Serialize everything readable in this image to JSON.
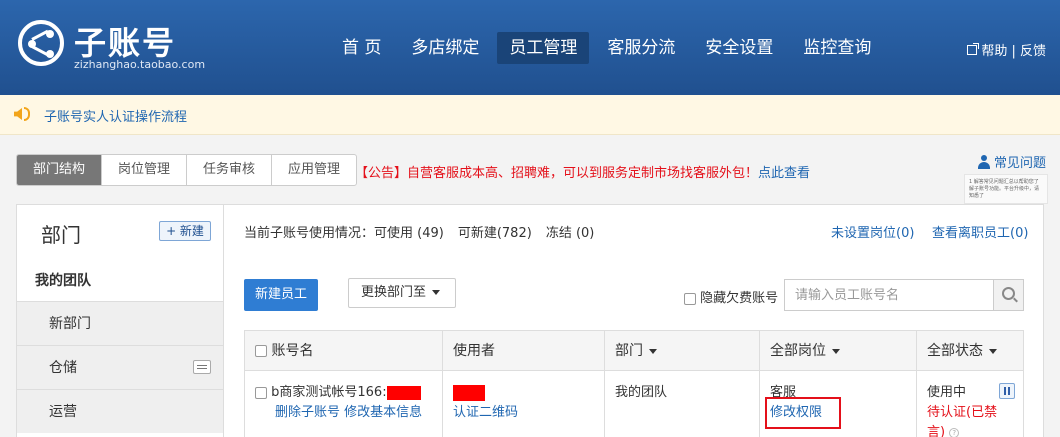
{
  "header": {
    "brand": "子账号",
    "brand_sub": "zizhanghao.taobao.com",
    "nav": [
      "首 页",
      "多店绑定",
      "员工管理",
      "客服分流",
      "安全设置",
      "监控查询"
    ],
    "help": "帮助 | 反馈"
  },
  "notice": {
    "text": "子账号实人认证操作流程"
  },
  "tabs": [
    "部门结构",
    "岗位管理",
    "任务审核",
    "应用管理"
  ],
  "announcement": {
    "prefix": "【公告】自营客服成本高、招聘难，可以到服务定制市场找客服外包！",
    "link": "点此查看"
  },
  "faq": {
    "label": "常见问题",
    "note": "1 解答常见问题汇总以帮助您了解子账号功能。平台升级中，请知悉了"
  },
  "left": {
    "title": "部门",
    "new_button": "+ 新建",
    "team": "我的团队",
    "depts": [
      "新部门",
      "仓储",
      "运营"
    ]
  },
  "usage": {
    "label": "当前子账号使用情况：",
    "available": "可使用 (49)",
    "creatable": "可新建(782)",
    "frozen": "冻结 (0)",
    "unset_post": "未设置岗位(0)",
    "view_departed": "查看离职员工(0)"
  },
  "toolbar": {
    "new_employee": "新建员工",
    "move_dept": "更换部门至",
    "hide_arrears": "隐藏欠费账号",
    "search_placeholder": "请输入员工账号名"
  },
  "table": {
    "headers": [
      "账号名",
      "使用者",
      "部门",
      "全部岗位",
      "全部状态"
    ],
    "row": {
      "account": "b商家测试帐号166:",
      "delete": "删除子账号",
      "edit": "修改基本信息",
      "qr": "认证二维码",
      "dept": "我的团队",
      "post": "客服",
      "modify": "修改权限",
      "status": "使用中",
      "pending": "待认证(已禁言)"
    }
  },
  "colors": {
    "header": "#2c66ad",
    "primary": "#2f7dd3",
    "link": "#1f66b1",
    "alert": "#e4101a"
  }
}
